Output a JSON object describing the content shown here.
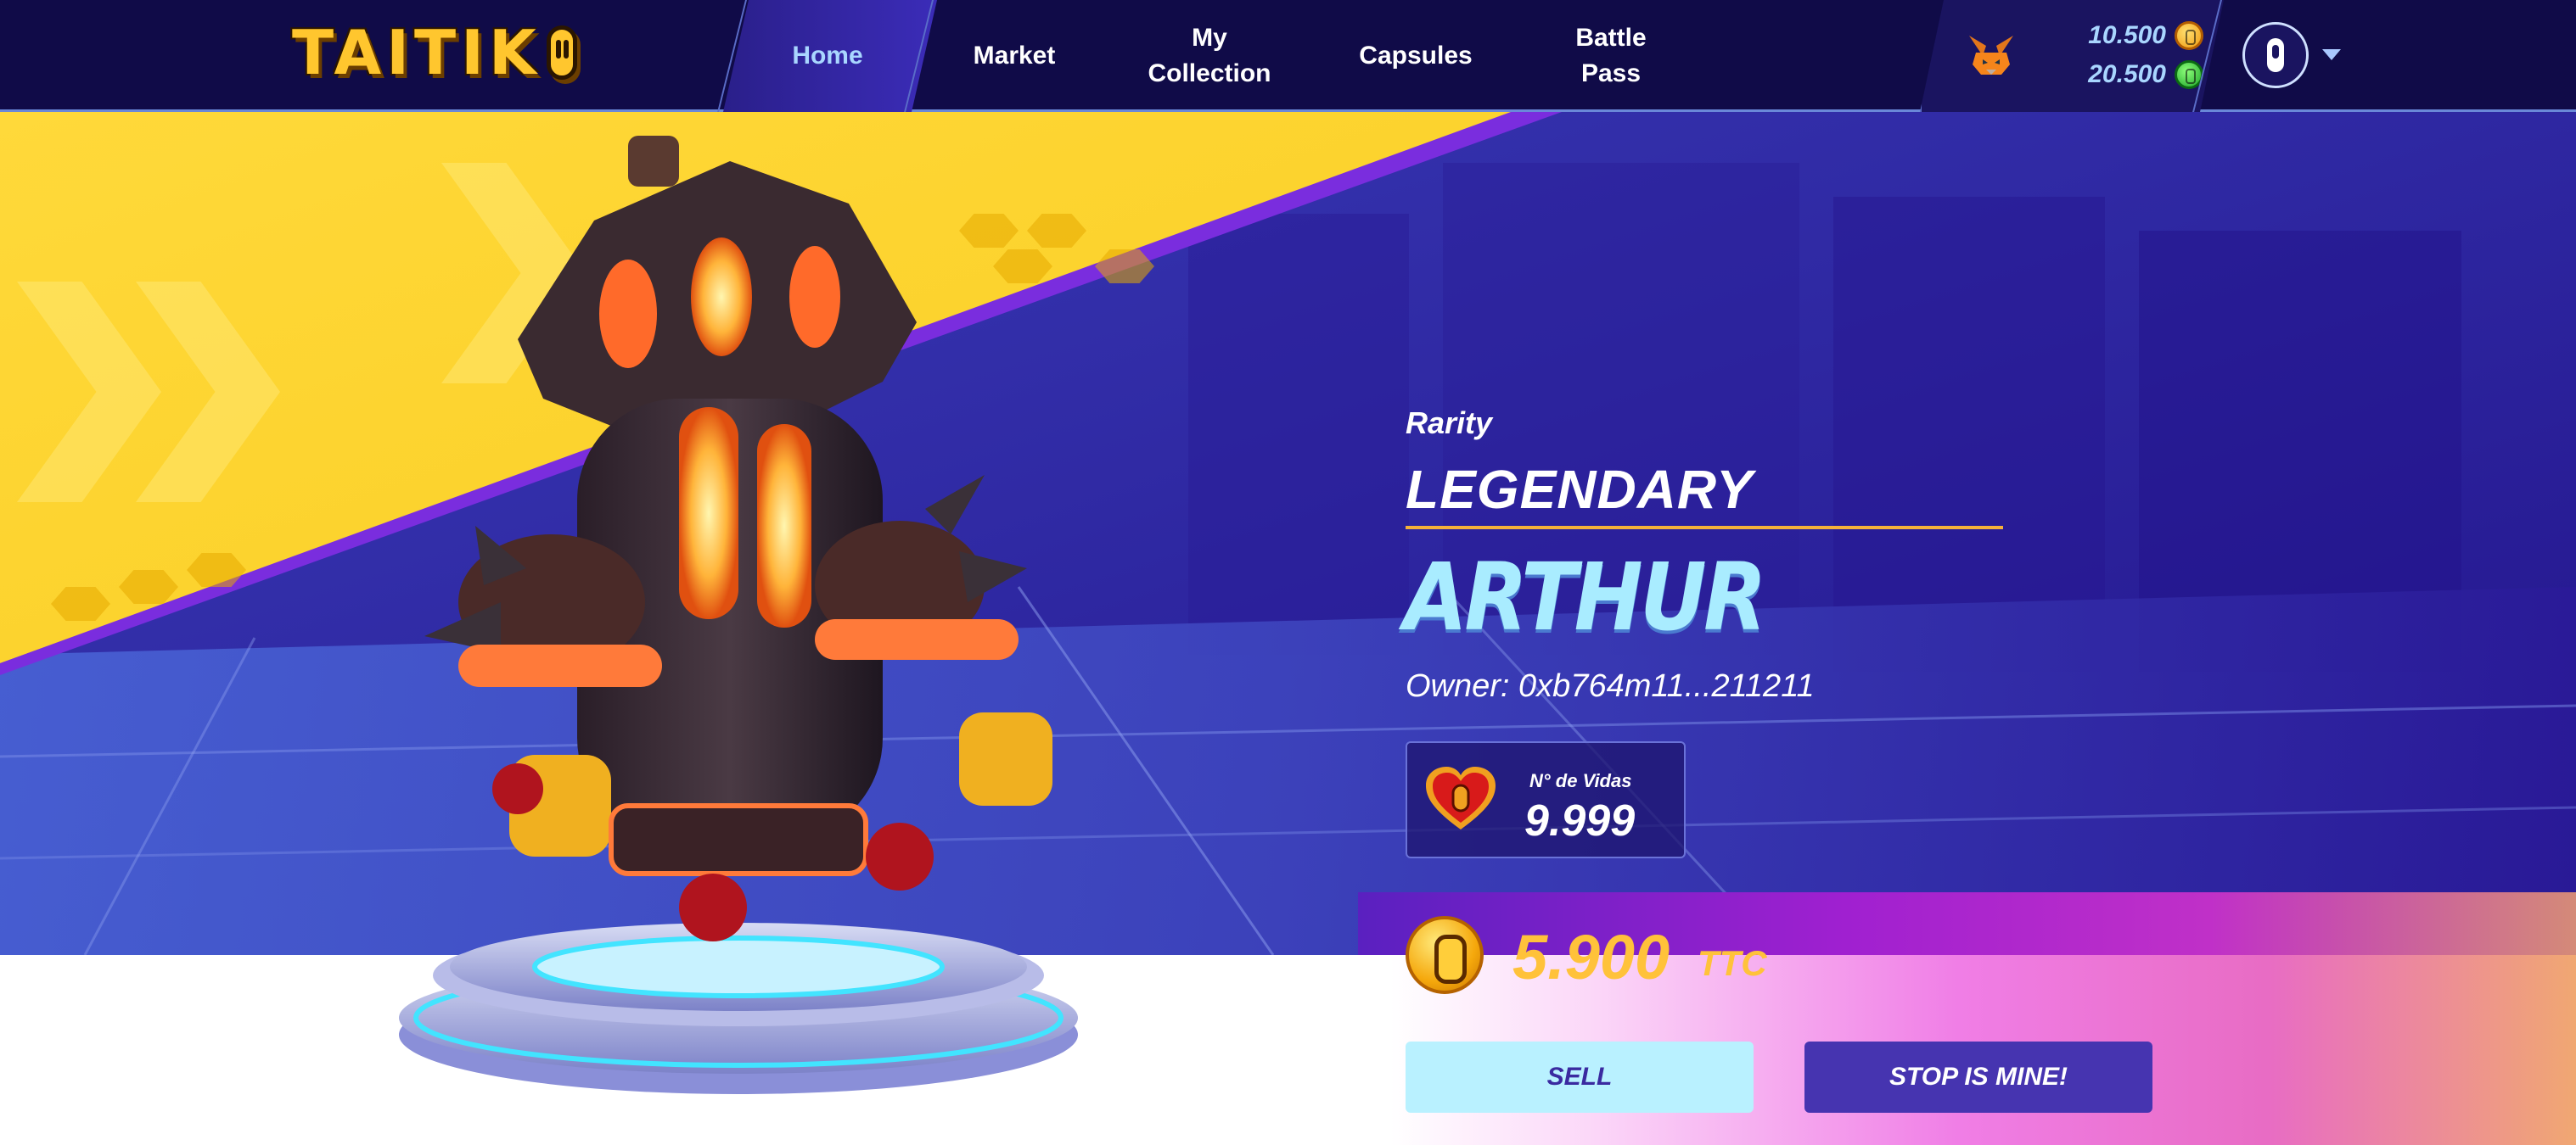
{
  "logo": {
    "text": "TAITIK"
  },
  "nav": {
    "items": [
      {
        "label": "Home",
        "active": true
      },
      {
        "label": "Market",
        "active": false
      },
      {
        "label": "My\nCollection",
        "active": false
      },
      {
        "label": "Capsules",
        "active": false
      },
      {
        "label": "Battle\nPass",
        "active": false
      }
    ]
  },
  "wallet": {
    "icon": "metamask-fox-icon",
    "balance_gold": "10.500",
    "balance_green": "20.500",
    "gold_coin_icon": "gold-coin-icon",
    "green_coin_icon": "green-coin-icon"
  },
  "user": {
    "avatar_icon": "capsule-avatar-icon",
    "menu_icon": "chevron-down-icon"
  },
  "item": {
    "rarity_label": "Rarity",
    "rarity_value": "LEGENDARY",
    "name": "ARTHUR",
    "owner": "Owner: 0xb764m11...211211",
    "lives_label": "N° de Vidas",
    "lives_value": "9.999",
    "price": "5.900",
    "price_unit": "TTC"
  },
  "actions": {
    "sell": "SELL",
    "buy": "STOP IS MINE!"
  },
  "colors": {
    "nav_bg": "#100b48",
    "accent_yellow": "#ffc23a",
    "name_cyan": "#a9ecff",
    "buy_button": "#4634b0",
    "sell_button": "#b9f1ff"
  }
}
